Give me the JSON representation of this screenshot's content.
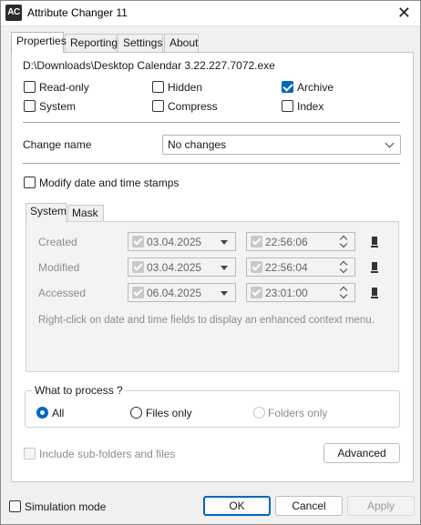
{
  "window": {
    "title": "Attribute Changer 11",
    "icon_text": "AC",
    "icons": {
      "app": "app-icon",
      "close": "close-icon"
    }
  },
  "tabs": [
    {
      "label": "Properties",
      "active": true
    },
    {
      "label": "Reporting",
      "active": false
    },
    {
      "label": "Settings",
      "active": false
    },
    {
      "label": "About",
      "active": false
    }
  ],
  "properties": {
    "file_path": "D:\\Downloads\\Desktop Calendar 3.22.227.7072.exe",
    "attributes": {
      "read_only": {
        "label": "Read-only",
        "checked": false
      },
      "hidden": {
        "label": "Hidden",
        "checked": false
      },
      "archive": {
        "label": "Archive",
        "checked": true
      },
      "system": {
        "label": "System",
        "checked": false
      },
      "compress": {
        "label": "Compress",
        "checked": false
      },
      "index": {
        "label": "Index",
        "checked": false
      }
    },
    "change_name": {
      "label": "Change name",
      "value": "No changes"
    },
    "modify_dates": {
      "label": "Modify date and time stamps",
      "checked": false
    },
    "subtabs": [
      {
        "label": "System",
        "active": true
      },
      {
        "label": "Mask",
        "active": false
      }
    ],
    "timestamps": [
      {
        "label": "Created",
        "date": "03.04.2025",
        "time": "22:56:06"
      },
      {
        "label": "Modified",
        "date": "03.04.2025",
        "time": "22:56:04"
      },
      {
        "label": "Accessed",
        "date": "06.04.2025",
        "time": "23:01:00"
      }
    ],
    "hint": "Right-click on date and time fields to display an enhanced context menu.",
    "process": {
      "title": "What to process ?",
      "options": [
        {
          "label": "All",
          "selected": true,
          "enabled": true
        },
        {
          "label": "Files only",
          "selected": false,
          "enabled": true
        },
        {
          "label": "Folders only",
          "selected": false,
          "enabled": false
        }
      ]
    },
    "include_subfolders": {
      "label": "Include sub-folders and files",
      "checked": false,
      "enabled": false
    },
    "advanced_label": "Advanced"
  },
  "footer": {
    "simulation": {
      "label": "Simulation mode",
      "checked": false
    },
    "ok": "OK",
    "cancel": "Cancel",
    "apply": "Apply"
  },
  "colors": {
    "accent": "#0067c0",
    "window_bg": "#f0f0f0",
    "panel_bg": "#ffffff"
  }
}
